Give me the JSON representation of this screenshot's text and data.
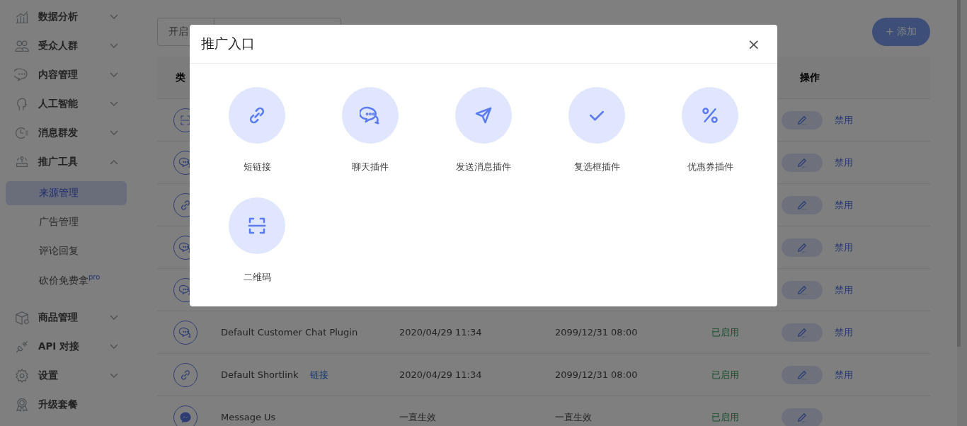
{
  "sidebar": {
    "items": [
      {
        "label": "数据分析",
        "expanded": false
      },
      {
        "label": "受众人群",
        "expanded": false
      },
      {
        "label": "内容管理",
        "expanded": false
      },
      {
        "label": "人工智能",
        "expanded": false
      },
      {
        "label": "消息群发",
        "expanded": false
      },
      {
        "label": "推广工具",
        "expanded": true,
        "children": [
          {
            "label": "来源管理",
            "selected": true
          },
          {
            "label": "广告管理",
            "selected": false
          },
          {
            "label": "评论回复",
            "selected": false
          },
          {
            "label": "砍价免费拿$^{pro}$",
            "selected": false
          }
        ]
      },
      {
        "label": "商品管理",
        "expanded": false
      },
      {
        "label": "API 对接",
        "expanded": false
      },
      {
        "label": "设置",
        "expanded": false
      },
      {
        "label": "升级套餐"
      }
    ]
  },
  "toolbar": {
    "filter": {
      "value": "开启"
    },
    "add_button": "+ 添加"
  },
  "table": {
    "header": {
      "type": "类",
      "actions": "操作"
    },
    "rows": [
      {
        "kind": "qrcode",
        "action": "禁用"
      },
      {
        "kind": "chat",
        "action": "禁用"
      },
      {
        "kind": "link",
        "action": "禁用"
      },
      {
        "kind": "chat",
        "action": "禁用"
      },
      {
        "kind": "chat",
        "action": "禁用"
      },
      {
        "kind": "chat",
        "name": "Default Customer Chat Plugin",
        "created": "2020/04/29 11:34",
        "expires": "2099/12/31 08:00",
        "status": "已启用",
        "action": "禁用"
      },
      {
        "kind": "link",
        "name": "Default Shortlink",
        "link": "链接",
        "created": "2020/04/29 11:34",
        "expires": "2099/12/31 08:00",
        "status": "已启用",
        "action": "禁用"
      },
      {
        "kind": "messenger",
        "name": "Message Us",
        "created": "一直生效",
        "expires": "一直生效",
        "status": "已启用"
      }
    ]
  },
  "modal": {
    "title": "推广入口",
    "close": "×",
    "items": [
      {
        "kind": "link",
        "label": "短链接"
      },
      {
        "kind": "chat",
        "label": "聊天插件"
      },
      {
        "kind": "send",
        "label": "发送消息插件"
      },
      {
        "kind": "check",
        "label": "复选框插件"
      },
      {
        "kind": "percent",
        "label": "优惠券插件"
      },
      {
        "kind": "qrcode",
        "label": "二维码"
      }
    ]
  }
}
